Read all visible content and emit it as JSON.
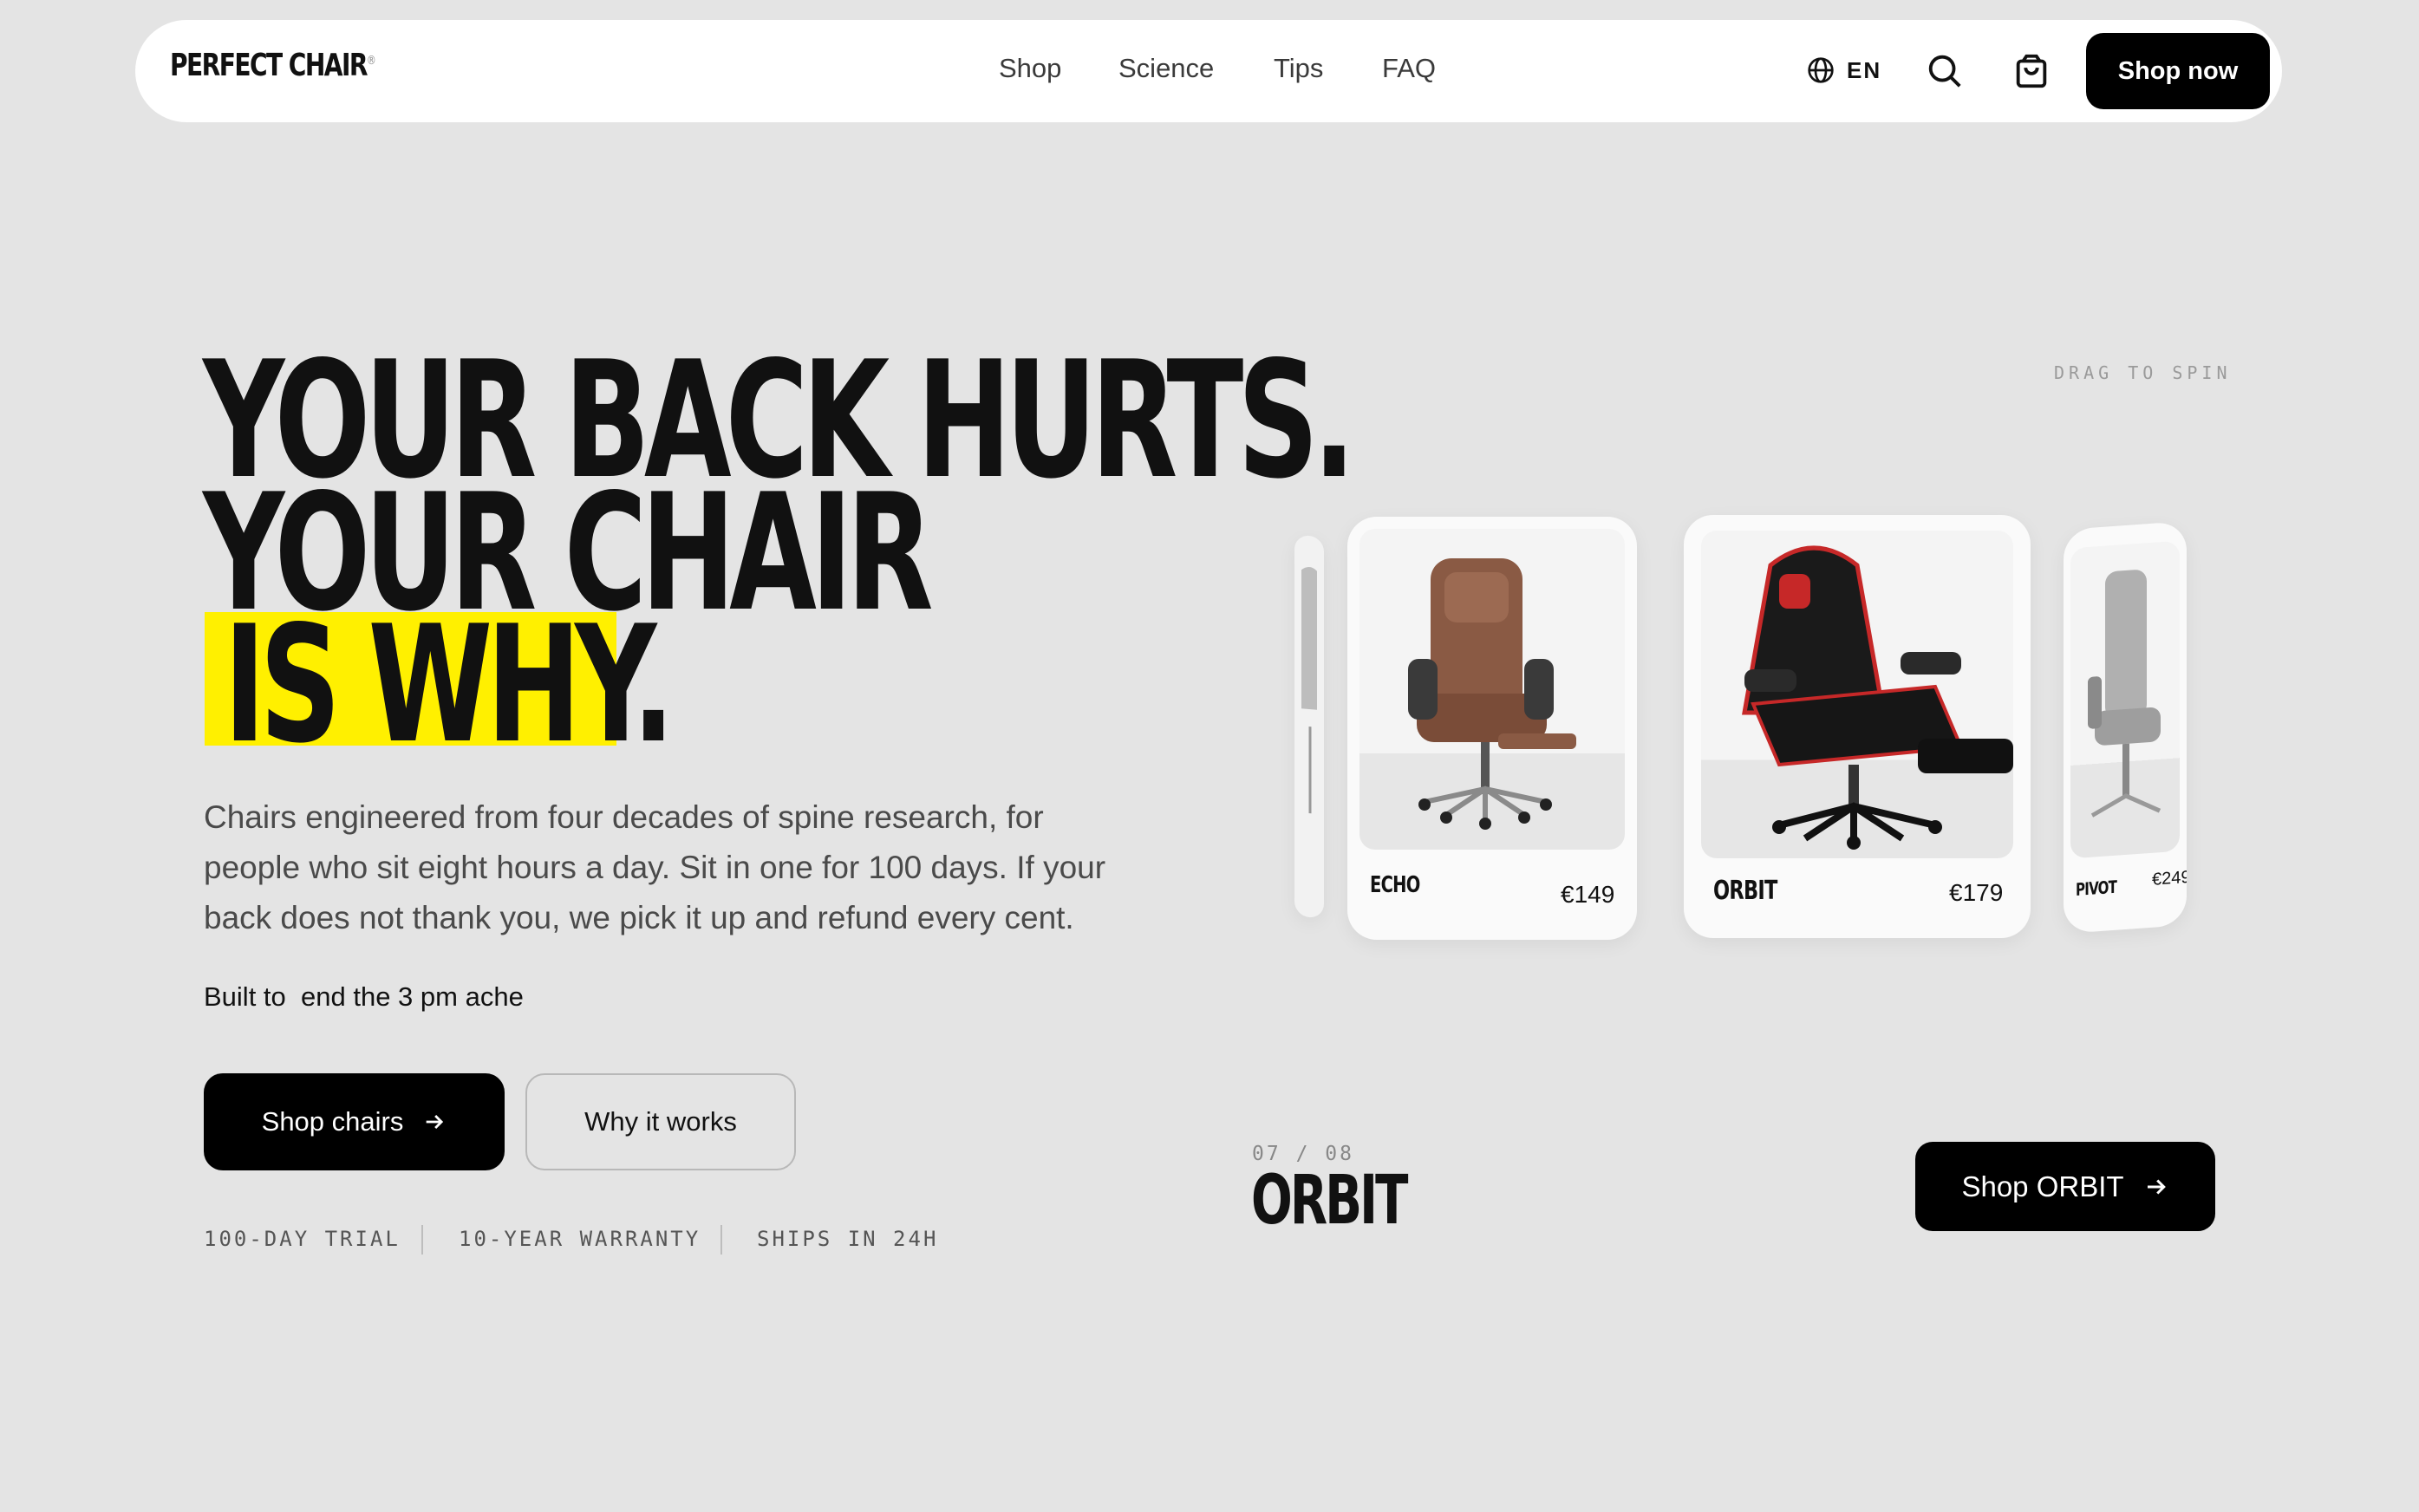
{
  "nav": {
    "logo": "PERFECT CHAIR",
    "logo_mark": "®",
    "links": [
      "Shop",
      "Science",
      "Tips",
      "FAQ"
    ],
    "language": "EN",
    "language_icon": "globe-icon",
    "search_icon": "search-icon",
    "cart_icon": "shopping-bag-icon",
    "cta": "Shop now"
  },
  "hero": {
    "headline_1": "YOUR BACK HURTS.",
    "headline_2": "YOUR CHAIR",
    "headline_3": "IS WHY.",
    "highlight_color": "#fff000",
    "description": "Chairs engineered from four decades of spine research, for people who sit eight hours a day. Sit in one for 100 days. If your back does not thank you, we pick it up and refund every cent.",
    "tagline_prefix": "Built to",
    "tagline_rotating": "end the 3 pm ache",
    "primary_cta": "Shop chairs",
    "secondary_cta": "Why it works",
    "perks": [
      "100-DAY TRIAL",
      "10-YEAR WARRANTY",
      "SHIPS IN 24H"
    ]
  },
  "carousel": {
    "hint": "DRAG TO SPIN",
    "cards": [
      {
        "name": "ECHO",
        "price": "€149",
        "color": "brown leather"
      },
      {
        "name": "ORBIT",
        "price": "€179",
        "color": "black and red gaming"
      },
      {
        "name": "PIVOT",
        "price": "€249",
        "color": "grey"
      }
    ],
    "counter_current": "07",
    "counter_sep": "/",
    "counter_total": "08",
    "current_name": "ORBIT",
    "cta": "Shop ORBIT",
    "arrow_icon": "arrow-right-icon"
  }
}
